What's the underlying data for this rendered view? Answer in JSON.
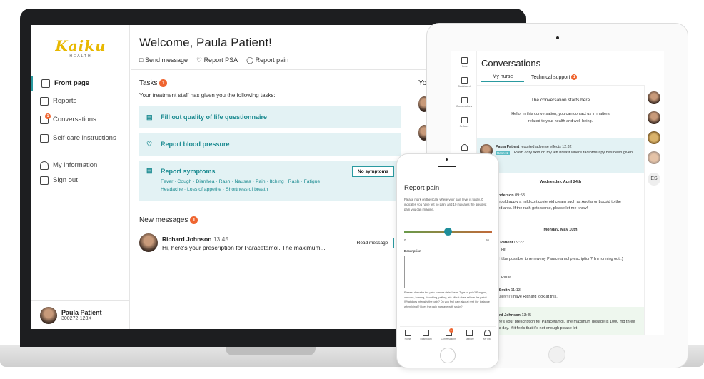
{
  "laptop": {
    "logo": {
      "brand": "Kaiku",
      "sub": "HEALTH"
    },
    "header": {
      "title": "Welcome, Paula Patient!",
      "actions": [
        "Send message",
        "Report PSA",
        "Report pain"
      ]
    },
    "nav": [
      "Front page",
      "Reports",
      "Conversations",
      "Self-care instructions",
      "My information",
      "Sign out"
    ],
    "conversations_badge": "1",
    "profile": {
      "name": "Paula Patient",
      "id": "300272-123X"
    },
    "tasks": {
      "title": "Tasks",
      "badge": "1",
      "intro": "Your treatment staff has given you the following tasks:",
      "items": [
        "Fill out quality of life questionnaire",
        "Report blood pressure",
        "Report symptoms"
      ],
      "symptoms_line1": "Fever · Cough · Diarrhea · Rash · Nausea · Pain · Itching · Rash · Fatigue",
      "symptoms_line2": "Headache · Loss of appetite · Shortness of breath",
      "no_symptoms": "No symptoms"
    },
    "messages": {
      "title": "New messages",
      "badge": "1",
      "sender": "Richard Johnson",
      "time": "13:45",
      "preview": "Hi, here's your prescription for Paracetamol. The maximum...",
      "read": "Read message"
    },
    "right_col_partial": "Yo"
  },
  "tablet": {
    "nav": [
      "Home",
      "Dashboard",
      "Conversations",
      "Selfcare"
    ],
    "title": "Conversations",
    "tabs": [
      "My nurse",
      "Technical support"
    ],
    "tab_badge": "1",
    "start": "The conversation starts here",
    "intro": "Hello! In this conversation, you can contact us in matters related to your health and well-being.",
    "msg1": {
      "who": "Paula Patient",
      "action": "reported adverse effects",
      "time": "12:32",
      "tag": "Rash: 1",
      "text": "Rash / dry skin on my left breast where radiotherapy has been given."
    },
    "date1": "Wednesday, April 24th",
    "msg2": {
      "who": "Bill Anderson",
      "time": "09:58",
      "text": "You should apply a mild corticosteroid cream such as Apolar or Locoid to the affected area. If the rash gets worse, please let me know!"
    },
    "date2": "Monday, May 10th",
    "msg3": {
      "who": "Paula Patient",
      "time": "09:22",
      "l1": "Hi!",
      "l2": "Would it be possible to renew my Paracetamol prescription? I'm running out :)",
      "l3": "Paula"
    },
    "msg4": {
      "who": "Alice Smith",
      "time": "11:13",
      "text": "Absolutely! I'll have Richard look at this."
    },
    "msg5": {
      "who": "Richard Johnson",
      "time": "13:45",
      "text": "Hi, here's your prescription for Paracetamol. The maximum dosage is 1000 mg three times a day. If it feels that it's not enough please let"
    },
    "initials": "ES"
  },
  "phone": {
    "title": "Report pain",
    "instructions": "Please mark on the scale where your pain level is today. 0 indicates you have felt no pain, and 10 indicates the greatest pain you can imagine.",
    "slider": {
      "min": "0",
      "max": "10",
      "value": 5
    },
    "desc_label": "Description",
    "help": "Please, describe the pain in more detail here. Type of pain? Pungent, obscure, burning, throbbing, pulling, etc. What does relieve the pain? What does intensify the pain? Do you feel pain also at rest (for instance when lying)? Does the pain increase with strain?",
    "nav": [
      "Home",
      "Dashboard",
      "Conversations",
      "Selfcare",
      "My info"
    ],
    "nav_badge": "1"
  },
  "colors": {
    "accent": "#2a9aa0",
    "badge": "#ef6530",
    "task_bg": "#e3f2f4",
    "logo": "#e8b800"
  }
}
